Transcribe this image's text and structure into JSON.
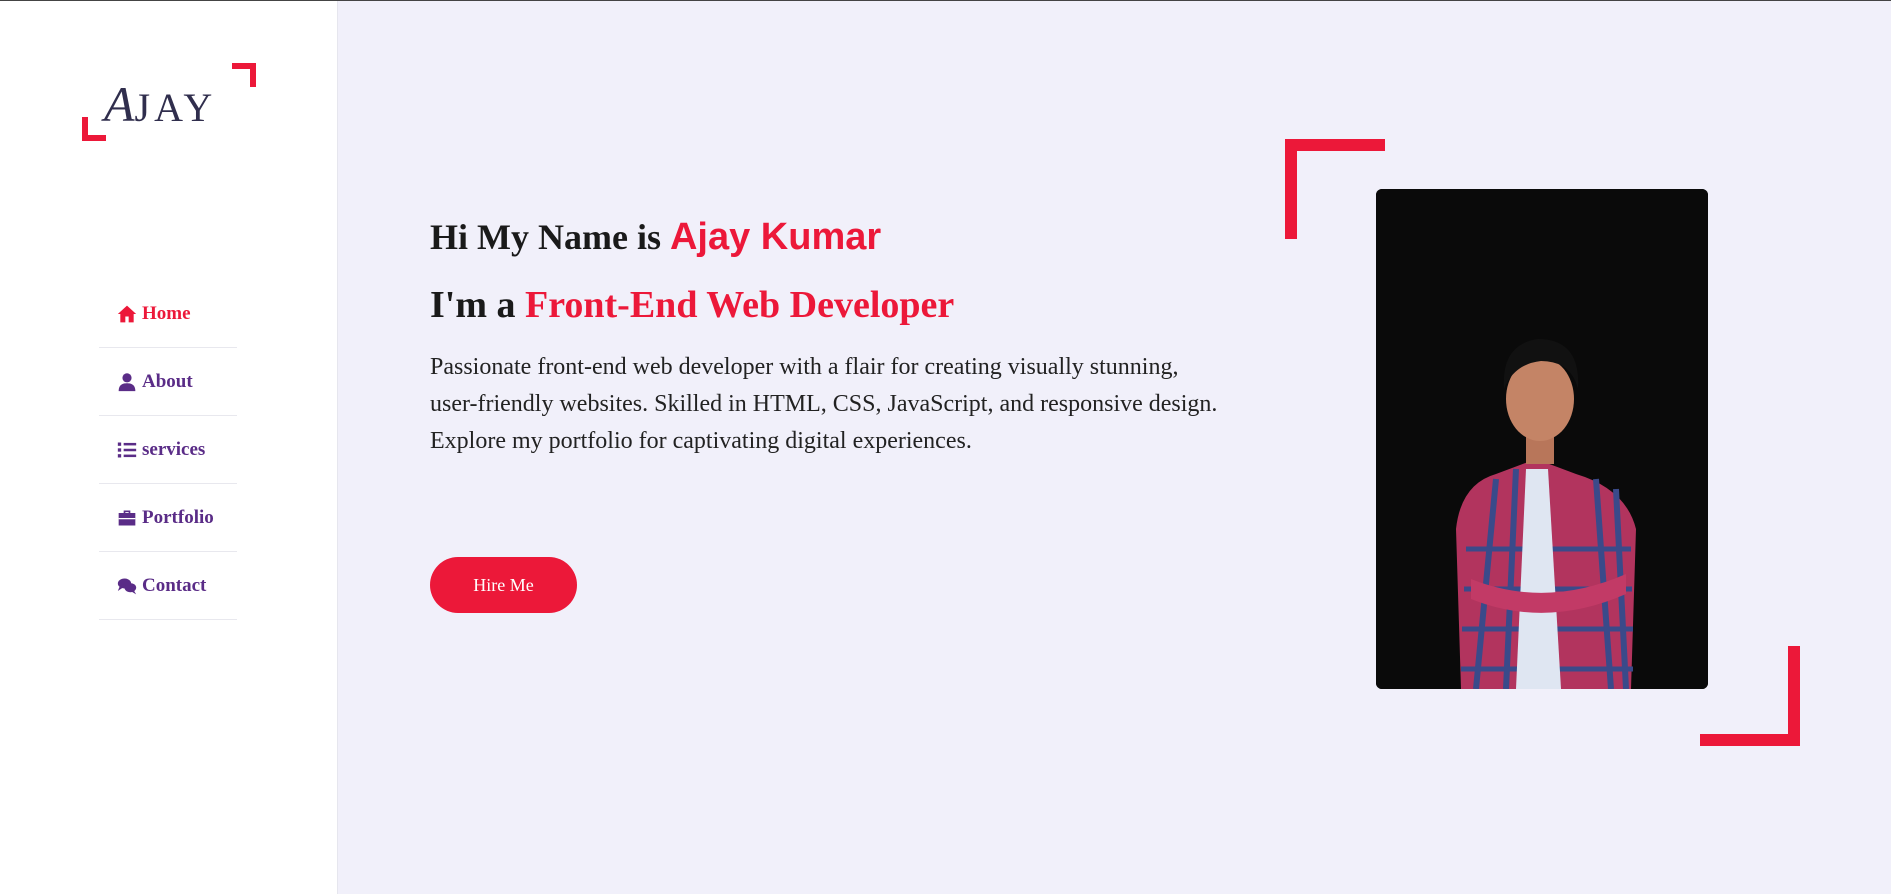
{
  "logo": {
    "first_letter": "A",
    "rest": "JAY"
  },
  "nav": {
    "items": [
      {
        "label": "Home",
        "icon": "home-icon",
        "active": true
      },
      {
        "label": "About",
        "icon": "user-icon",
        "active": false
      },
      {
        "label": "services",
        "icon": "list-icon",
        "active": false
      },
      {
        "label": "Portfolio",
        "icon": "briefcase-icon",
        "active": false
      },
      {
        "label": "Contact",
        "icon": "comments-icon",
        "active": false
      }
    ]
  },
  "hero": {
    "greeting": "Hi My Name is ",
    "name": "Ajay Kumar",
    "role_prefix": "I'm a ",
    "role": "Front-End Web Developer",
    "description": "Passionate front-end web developer with a flair for creating visually stunning, user-friendly websites. Skilled in HTML, CSS, JavaScript, and responsive design. Explore my portfolio for captivating digital experiences.",
    "cta_label": "Hire Me"
  },
  "colors": {
    "accent": "#ec1839",
    "nav_text": "#5a2c87",
    "background": "#f1f0fa",
    "sidebar": "#ffffff"
  }
}
